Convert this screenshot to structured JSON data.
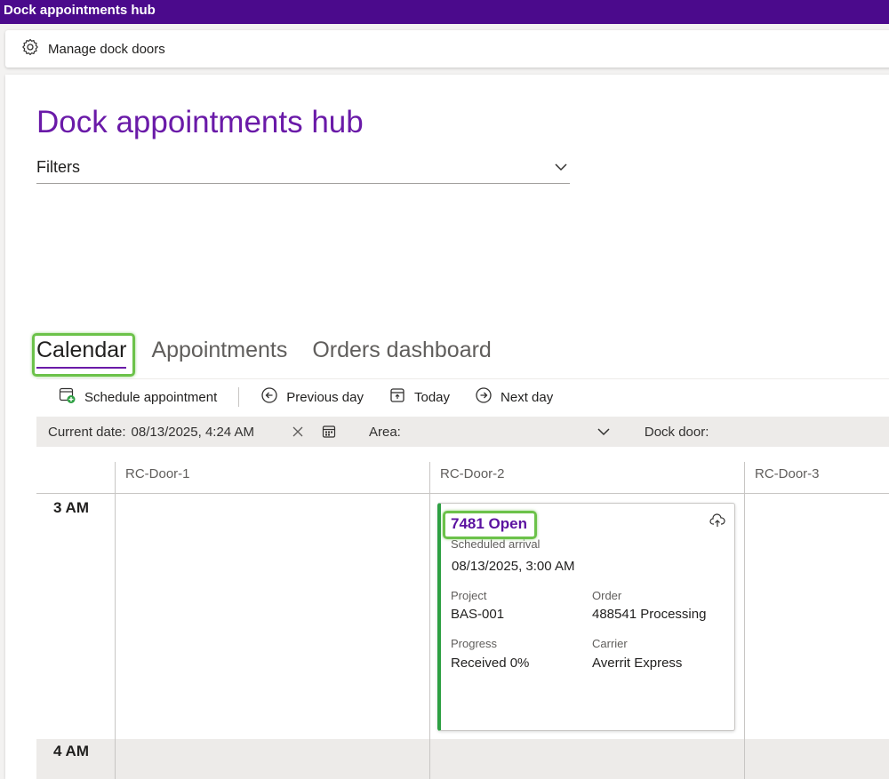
{
  "window": {
    "title": "Dock appointments hub"
  },
  "actions": {
    "manage_doors_label": "Manage dock doors"
  },
  "page": {
    "title": "Dock appointments hub"
  },
  "filters": {
    "label": "Filters"
  },
  "tabs": [
    {
      "label": "Calendar",
      "active": true
    },
    {
      "label": "Appointments",
      "active": false
    },
    {
      "label": "Orders dashboard",
      "active": false
    }
  ],
  "toolbar": {
    "schedule_label": "Schedule appointment",
    "previous_label": "Previous day",
    "today_label": "Today",
    "next_label": "Next day"
  },
  "datebar": {
    "current_date_label": "Current date:",
    "current_date_value": "08/13/2025, 4:24 AM",
    "area_label": "Area:",
    "dock_door_label": "Dock door:"
  },
  "calendar": {
    "columns": [
      "RC-Door-1",
      "RC-Door-2",
      "RC-Door-3"
    ],
    "hours": [
      "3 AM",
      "4 AM"
    ]
  },
  "appointment": {
    "title": "7481 Open",
    "scheduled_arrival_label": "Scheduled arrival",
    "scheduled_arrival_value": "08/13/2025, 3:00 AM",
    "project_label": "Project",
    "project_value": "BAS-001",
    "order_label": "Order",
    "order_value": "488541 Processing",
    "progress_label": "Progress",
    "progress_value": "Received 0%",
    "carrier_label": "Carrier",
    "carrier_value": "Averrit Express",
    "status_color": "#2ea043"
  },
  "colors": {
    "brand": "#4b0a8c",
    "accent": "#6a1aa8",
    "highlight": "#6cc24a"
  }
}
